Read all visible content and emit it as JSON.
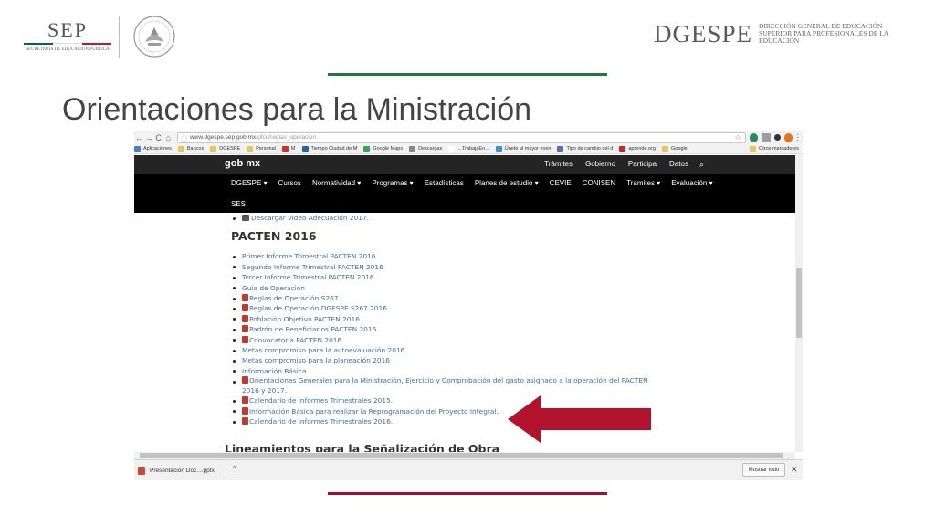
{
  "slide": {
    "title": "Orientaciones para la Ministración",
    "green_line_color": "#1e7a3c",
    "red_line_color": "#a3102a",
    "arrow_color": "#b3122d"
  },
  "header": {
    "sep_word": "SEP",
    "sep_sub": "SECRETARÍA DE EDUCACIÓN PÚBLICA",
    "sep_bar_colors": [
      "#006847",
      "#ffffff",
      "#ce1126"
    ],
    "seal_icon": "mexico-coat-of-arms",
    "dgespe_word": "DGESPE",
    "dgespe_sub": "DIRECCIÓN GENERAL DE EDUCACIÓN SUPERIOR PARA PROFESIONALES DE LA EDUCACIÓN"
  },
  "browser": {
    "back": "←",
    "forward": "→",
    "reload": "C",
    "home": "⌂",
    "url_host": "www.dgespe.sep.gob.mx",
    "url_path": "/pfce/reglas_operacion",
    "bookmarks": [
      {
        "label": "Aplicaciones",
        "color": "#4a7bd0"
      },
      {
        "label": "Bancos",
        "color": "#e9c45a"
      },
      {
        "label": "DGESPE",
        "color": "#e9c45a"
      },
      {
        "label": "Personal",
        "color": "#e9c45a"
      },
      {
        "label": "M",
        "color": "#d93025"
      },
      {
        "label": "Tiempo Ciudad de M",
        "color": "#2b5fb3"
      },
      {
        "label": "Google Maps",
        "color": "#34a853"
      },
      {
        "label": "Descargas",
        "color": "#888888"
      },
      {
        "label": "...TrabajaEn...",
        "color": "#ffffff"
      },
      {
        "label": "Únete al mayor even",
        "color": "#3a8fd8"
      },
      {
        "label": "Tipo de cambio del d",
        "color": "#5b6cb8"
      },
      {
        "label": "aprende.org",
        "color": "#c62828"
      },
      {
        "label": "Google",
        "color": "#e9c45a"
      }
    ],
    "other_bookmarks": "Otros marcadores"
  },
  "site": {
    "gob_logo": "gob mx",
    "gob_links": [
      "Trámites",
      "Gobierno",
      "Participa",
      "Datos"
    ],
    "nav": [
      "DGESPE ▾",
      "Cursos",
      "Normatividad ▾",
      "Programas ▾",
      "Estadísticas",
      "Planes de estudio ▾",
      "CEVIE",
      "CONISEN",
      "Tramites ▾",
      "Evaluación ▾"
    ],
    "nav2": "SES",
    "top_item": "Descargar video Adecuación 2017.",
    "section_title": "PACTEN 2016",
    "items": [
      {
        "text": "Primer Informe Trimestral PACTEN 2016",
        "pdf": false
      },
      {
        "text": "Segundo Informe Trimestral PACTEN 2016",
        "pdf": false
      },
      {
        "text": "Tercer Informe Trimestral PACTEN 2016",
        "pdf": false
      },
      {
        "text": "Guía de Operación",
        "pdf": false
      },
      {
        "text": "Reglas de Operación S267.",
        "pdf": true
      },
      {
        "text": "Reglas de Operación DGESPE S267 2016.",
        "pdf": true
      },
      {
        "text": "Población Objetivo PACTEN 2016.",
        "pdf": true
      },
      {
        "text": "Padrón de Beneficiarios PACTEN 2016.",
        "pdf": true
      },
      {
        "text": "Convocatoria PACTEN 2016.",
        "pdf": true
      },
      {
        "text": "Metas compromiso para la autoevaluación 2016",
        "pdf": false
      },
      {
        "text": "Metas compromiso para la planeación 2016",
        "pdf": false
      },
      {
        "text": "Información Básica",
        "pdf": false
      },
      {
        "text": "Orientaciones Generales para la Ministración, Ejercicio y Comprobación del gasto asignado a la operación del PACTEN 2016 y 2017.",
        "pdf": true
      },
      {
        "text": "Calendario de Informes Trimestrales 2015.",
        "pdf": true
      },
      {
        "text": "Información Básica para realizar la Reprogramación del Proyecto Integral.",
        "pdf": true
      },
      {
        "text": "Calendario de Informes Trimestrales 2016.",
        "pdf": true
      }
    ],
    "bottom_heading": "Lineamientos para la Señalización de Obra"
  },
  "downloads": {
    "file": "Presentación Doc....pptx",
    "show_all": "Mostrar todo",
    "close": "✕"
  }
}
